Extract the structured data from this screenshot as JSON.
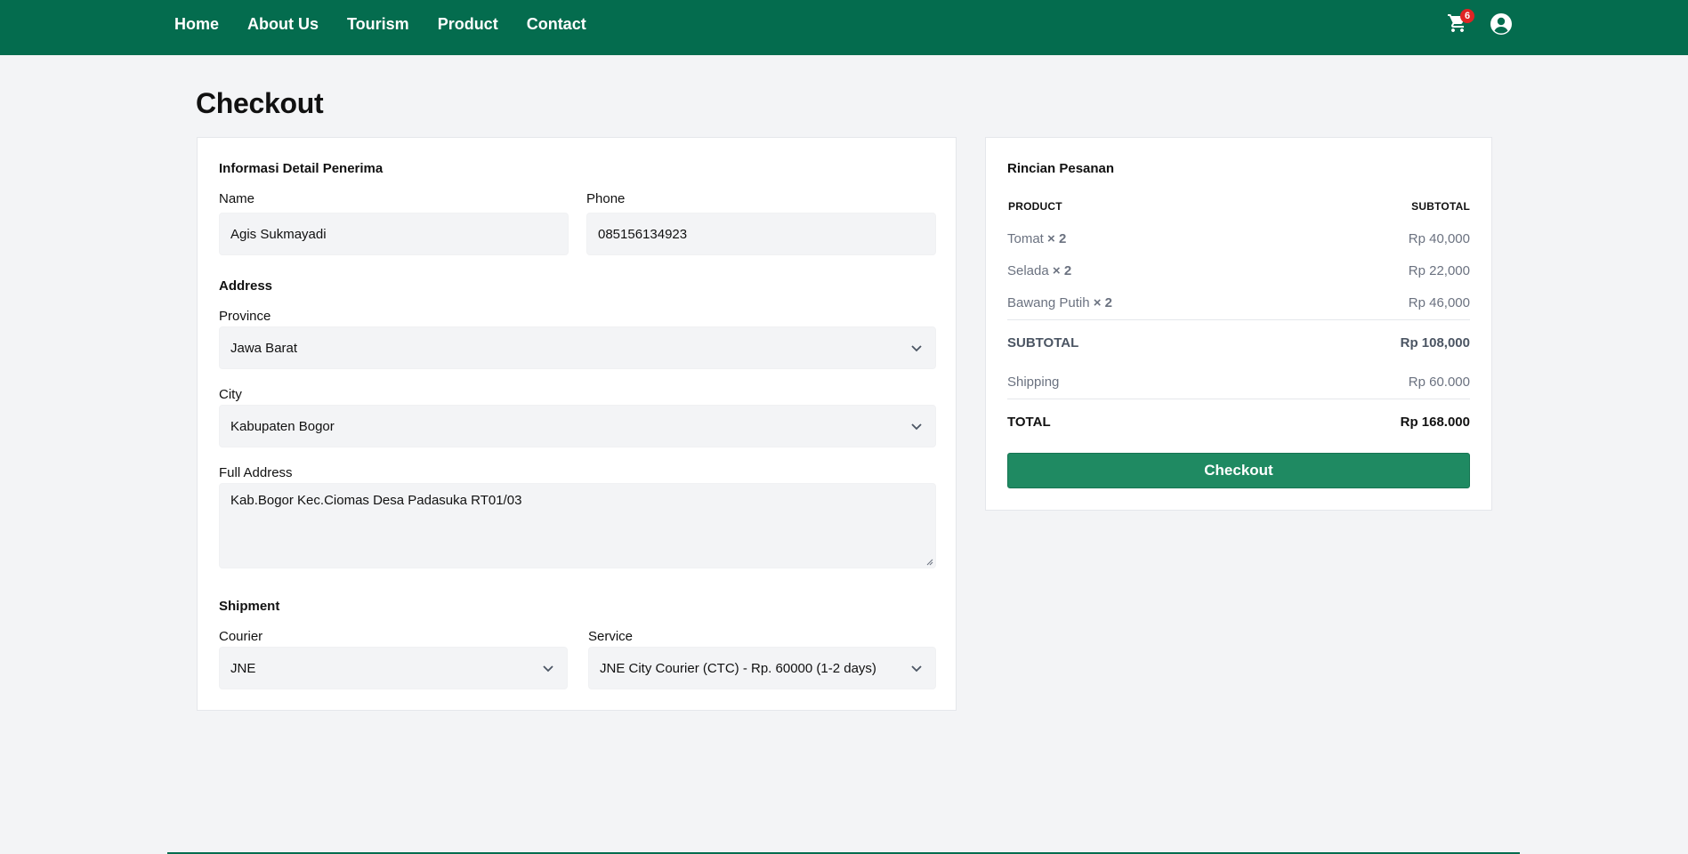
{
  "nav": {
    "links": [
      "Home",
      "About Us",
      "Tourism",
      "Product",
      "Contact"
    ],
    "cart_count": "6",
    "cart_icon": "cart-icon",
    "user_icon": "user-circle-icon"
  },
  "page": {
    "title": "Checkout"
  },
  "form": {
    "recipient_title": "Informasi Detail Penerima",
    "name_label": "Name",
    "name_value": "Agis Sukmayadi",
    "phone_label": "Phone",
    "phone_value": "085156134923",
    "address_title": "Address",
    "province_label": "Province",
    "province_value": "Jawa Barat",
    "city_label": "City",
    "city_value": "Kabupaten Bogor",
    "full_address_label": "Full Address",
    "full_address_value": "Kab.Bogor Kec.Ciomas Desa Padasuka RT01/03",
    "shipment_title": "Shipment",
    "courier_label": "Courier",
    "courier_value": "JNE",
    "service_label": "Service",
    "service_value": "JNE City Courier (CTC) - Rp. 60000 (1-2 days)"
  },
  "summary": {
    "title": "Rincian Pesanan",
    "product_header": "PRODUCT",
    "subtotal_header": "SUBTOTAL",
    "items": [
      {
        "name": "Tomat",
        "qty": "× 2",
        "price": "Rp 40,000"
      },
      {
        "name": "Selada",
        "qty": "× 2",
        "price": "Rp 22,000"
      },
      {
        "name": "Bawang Putih",
        "qty": "× 2",
        "price": "Rp 46,000"
      }
    ],
    "subtotal_label": "SUBTOTAL",
    "subtotal_value": "Rp 108,000",
    "shipping_label": "Shipping",
    "shipping_value": "Rp 60.000",
    "total_label": "TOTAL",
    "total_value": "Rp 168.000",
    "checkout_label": "Checkout"
  },
  "colors": {
    "header": "#046c4e",
    "button": "#1f8a62",
    "badge": "#e02424"
  }
}
